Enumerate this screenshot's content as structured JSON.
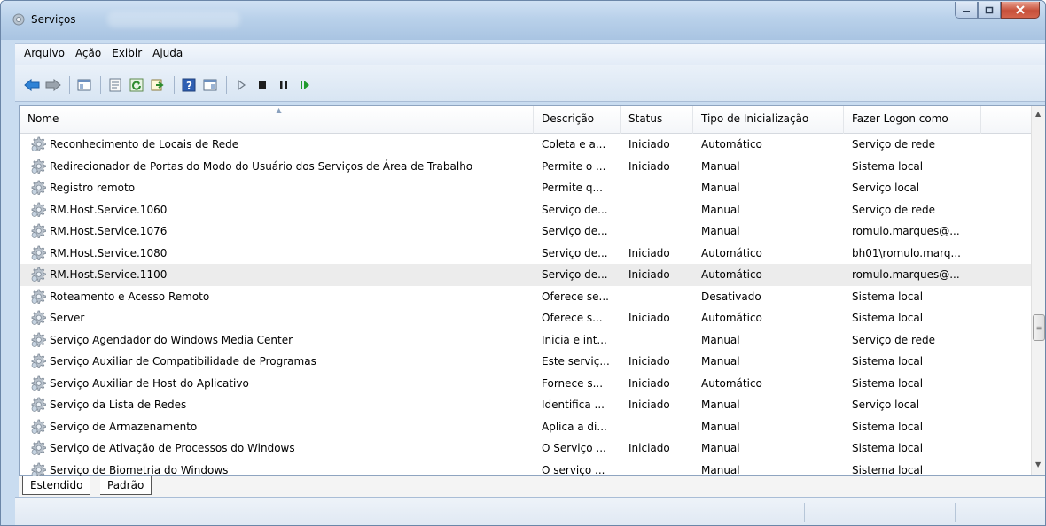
{
  "window": {
    "title": "Serviços"
  },
  "menu": [
    {
      "label": "Arquivo"
    },
    {
      "label": "Ação"
    },
    {
      "label": "Exibir"
    },
    {
      "label": "Ajuda"
    }
  ],
  "toolbar": [
    {
      "icon": "back-arrow-icon"
    },
    {
      "icon": "forward-arrow-icon"
    },
    {
      "icon": "show-hide-console-tree-icon"
    },
    {
      "icon": "properties-icon"
    },
    {
      "icon": "refresh-icon"
    },
    {
      "icon": "export-list-icon"
    },
    {
      "icon": "help-icon"
    },
    {
      "icon": "show-hide-action-pane-icon"
    },
    {
      "icon": "start-service-icon"
    },
    {
      "icon": "stop-service-icon"
    },
    {
      "icon": "pause-service-icon"
    },
    {
      "icon": "restart-service-icon"
    }
  ],
  "columns": {
    "name": "Nome",
    "desc": "Descrição",
    "status": "Status",
    "tipo": "Tipo de Inicialização",
    "logon": "Fazer Logon como"
  },
  "rows": [
    {
      "name": "Reconhecimento de Locais de Rede",
      "desc": "Coleta e a...",
      "status": "Iniciado",
      "tipo": "Automático",
      "logon": "Serviço de rede"
    },
    {
      "name": "Redirecionador de Portas do Modo do Usuário dos Serviços de Área de Trabalho",
      "desc": "Permite o ...",
      "status": "Iniciado",
      "tipo": "Manual",
      "logon": "Sistema local"
    },
    {
      "name": "Registro remoto",
      "desc": "Permite q...",
      "status": "",
      "tipo": "Manual",
      "logon": "Serviço local"
    },
    {
      "name": "RM.Host.Service.1060",
      "desc": "Serviço de...",
      "status": "",
      "tipo": "Manual",
      "logon": "Serviço de rede"
    },
    {
      "name": "RM.Host.Service.1076",
      "desc": "Serviço de...",
      "status": "",
      "tipo": "Manual",
      "logon": "romulo.marques@..."
    },
    {
      "name": "RM.Host.Service.1080",
      "desc": "Serviço de...",
      "status": "Iniciado",
      "tipo": "Automático",
      "logon": "bh01\\romulo.marq..."
    },
    {
      "name": "RM.Host.Service.1100",
      "desc": "Serviço de...",
      "status": "Iniciado",
      "tipo": "Automático",
      "logon": "romulo.marques@...",
      "selected": true
    },
    {
      "name": "Roteamento e Acesso Remoto",
      "desc": "Oferece se...",
      "status": "",
      "tipo": "Desativado",
      "logon": "Sistema local"
    },
    {
      "name": "Server",
      "desc": "Oferece s...",
      "status": "Iniciado",
      "tipo": "Automático",
      "logon": "Sistema local"
    },
    {
      "name": "Serviço Agendador do Windows Media Center",
      "desc": "Inicia e int...",
      "status": "",
      "tipo": "Manual",
      "logon": "Serviço de rede"
    },
    {
      "name": "Serviço Auxiliar de Compatibilidade de Programas",
      "desc": "Este serviç...",
      "status": "Iniciado",
      "tipo": "Manual",
      "logon": "Sistema local"
    },
    {
      "name": "Serviço Auxiliar de Host do Aplicativo",
      "desc": "Fornece s...",
      "status": "Iniciado",
      "tipo": "Automático",
      "logon": "Sistema local"
    },
    {
      "name": "Serviço da Lista de Redes",
      "desc": "Identifica ...",
      "status": "Iniciado",
      "tipo": "Manual",
      "logon": "Serviço local"
    },
    {
      "name": "Serviço de Armazenamento",
      "desc": "Aplica a di...",
      "status": "",
      "tipo": "Manual",
      "logon": "Sistema local"
    },
    {
      "name": "Serviço de Ativação de Processos do Windows",
      "desc": "O Serviço ...",
      "status": "Iniciado",
      "tipo": "Manual",
      "logon": "Sistema local"
    },
    {
      "name": "Serviço de Biometria do Windows",
      "desc": "O serviço ...",
      "status": "",
      "tipo": "Manual",
      "logon": "Sistema local"
    }
  ],
  "tabs": [
    {
      "label": "Estendido"
    },
    {
      "label": "Padrão"
    }
  ]
}
